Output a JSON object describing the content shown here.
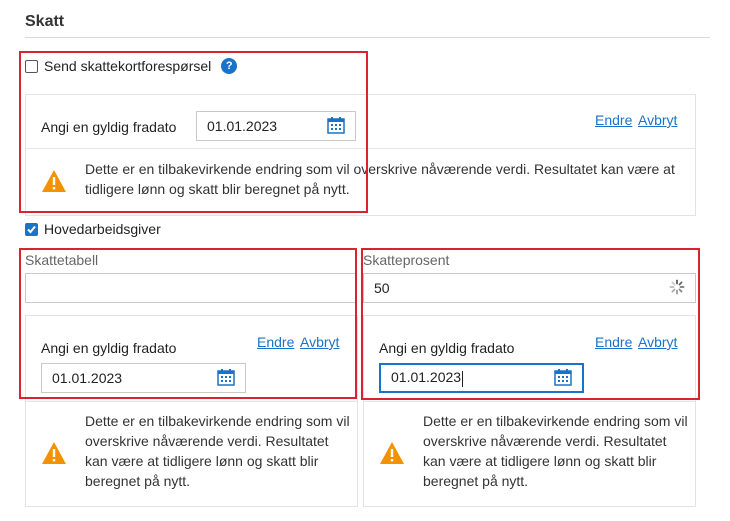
{
  "section": {
    "title": "Skatt"
  },
  "skattekort": {
    "checkbox_label": "Send skattekortforespørsel",
    "checked": false,
    "help_icon": "question-circle-icon",
    "fradato_label": "Angi en gyldig fradato",
    "fradato_value": "01.01.2023",
    "endre_label": "Endre",
    "avbryt_label": "Avbryt",
    "warning": "Dette er en tilbakevirkende endring som vil overskrive nåværende verdi. Resultatet kan være at tidligere lønn og skatt blir beregnet på nytt."
  },
  "hovedarbeidsgiver": {
    "checkbox_label": "Hovedarbeidsgiver",
    "checked": true
  },
  "skattetabell": {
    "label": "Skattetabell",
    "value": "",
    "fradato_label": "Angi en gyldig fradato",
    "fradato_value": "01.01.2023",
    "endre_label": "Endre",
    "avbryt_label": "Avbryt",
    "warning": "Dette er en tilbakevirkende endring som vil overskrive nåværende verdi. Resultatet kan være at tidligere lønn og skatt blir beregnet på nytt."
  },
  "skatteprosent": {
    "label": "Skatteprosent",
    "value": "50",
    "fradato_label": "Angi en gyldig fradato",
    "fradato_value": "01.01.2023",
    "endre_label": "Endre",
    "avbryt_label": "Avbryt",
    "warning": "Dette er en tilbakevirkende endring som vil overskrive nåværende verdi. Resultatet kan være at tidligere lønn og skatt blir beregnet på nytt."
  },
  "colors": {
    "accent": "#1a73c8",
    "highlight_border": "#d9232e",
    "warning": "#f39200"
  },
  "icons": {
    "calendar": "calendar-icon",
    "warning": "warning-triangle-icon",
    "spinner": "loading-spinner-icon"
  }
}
